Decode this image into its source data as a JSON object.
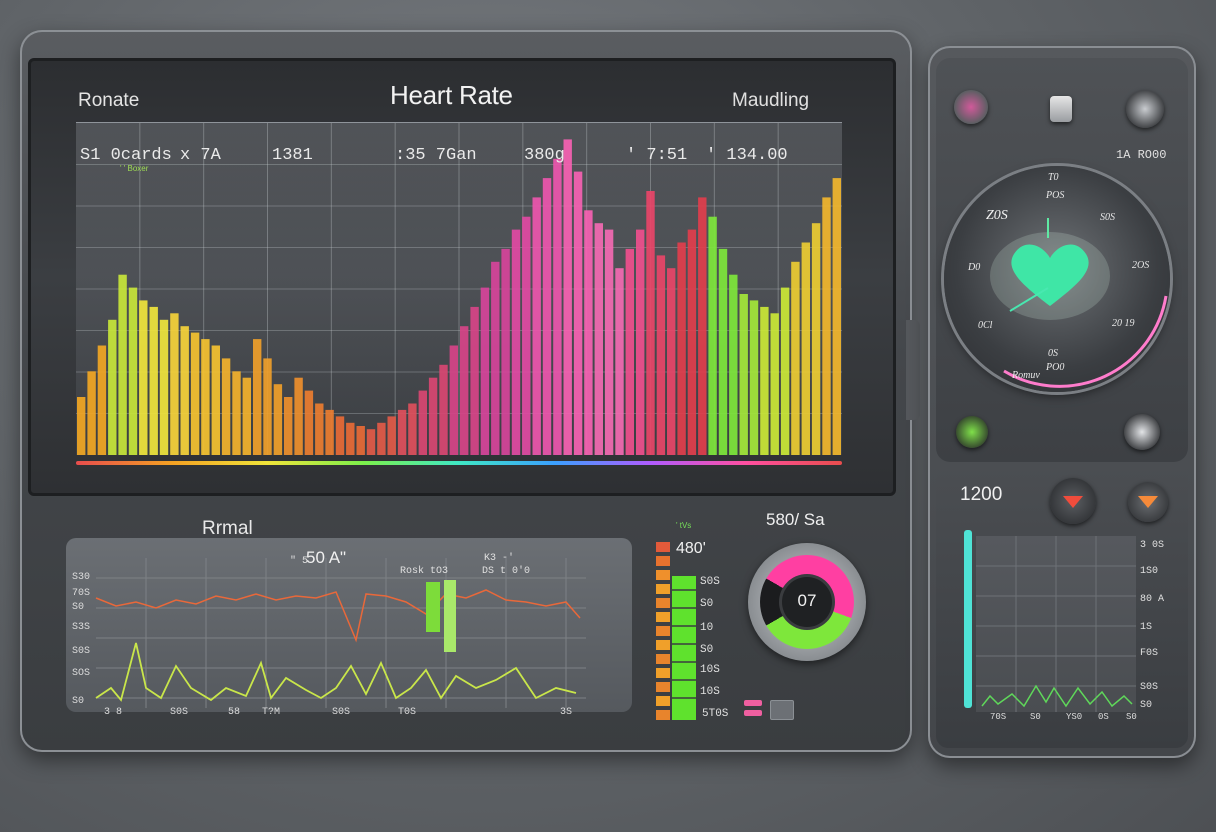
{
  "main_screen": {
    "title": "Heart Rate",
    "label_left": "Ronate",
    "label_right": "Maudling",
    "readouts": [
      "S1 0cards",
      "x 7A",
      "1381",
      ":35 7Gan",
      "380g",
      "' 7:51",
      "' 134.00"
    ],
    "tiny_caption": "' ' Boxer",
    "chart_data": {
      "type": "bar",
      "values": [
        18,
        26,
        34,
        42,
        56,
        52,
        48,
        46,
        42,
        44,
        40,
        38,
        36,
        34,
        30,
        26,
        24,
        36,
        30,
        22,
        18,
        24,
        20,
        16,
        14,
        12,
        10,
        9,
        8,
        10,
        12,
        14,
        16,
        20,
        24,
        28,
        34,
        40,
        46,
        52,
        60,
        64,
        70,
        74,
        80,
        86,
        92,
        98,
        88,
        76,
        72,
        70,
        58,
        64,
        70,
        82,
        62,
        58,
        66,
        70,
        80,
        74,
        64,
        56,
        50,
        48,
        46,
        44,
        52,
        60,
        66,
        72,
        80,
        86
      ],
      "colors": [
        "#f2a724",
        "#c8e63a",
        "#f0e53c",
        "#f6d23a",
        "#f5c230",
        "#f3b22c",
        "#f0a02a",
        "#ee8f2c",
        "#eb7d30",
        "#e86a36",
        "#e25a48",
        "#de4f5c",
        "#d94772",
        "#d74488",
        "#d6449a",
        "#e14aa3",
        "#ec56ac",
        "#f662b2",
        "#f36ab2",
        "#ef4f8d",
        "#e84568",
        "#e13e4c",
        "#7ee73b",
        "#a4e83a",
        "#cbe836",
        "#eccc32",
        "#f2b62c"
      ]
    },
    "gradient_colors": [
      "#e84d4d",
      "#f4a123",
      "#f0e43a",
      "#7cf04b",
      "#3fe7c5",
      "#3ba0ff",
      "#b05cff",
      "#ff4fa0"
    ]
  },
  "lower": {
    "label": "Rrmal",
    "ecg_mid": "50 A\"",
    "ecg_small_labels": [
      "\" 5",
      "Rosk tO3",
      "DS t 0'0",
      "K3 -'"
    ],
    "y_ticks": [
      "S30",
      "70S",
      "S0",
      "S3S",
      "S0S",
      "SOS",
      "S0"
    ],
    "x_ticks": [
      "3 8",
      "S0S",
      "58",
      "T?M",
      "S0S",
      "T0S",
      "3S"
    ],
    "bars": {
      "top_text": "' tVs",
      "value": "480'",
      "labels": [
        "S0S",
        "S0",
        "10",
        "S0",
        "10S",
        "10S",
        "5T0S"
      ]
    },
    "gauge": {
      "label": "580/ Sa",
      "value": "07"
    }
  },
  "right_panel": {
    "code": "1A RO00",
    "dial_labels": [
      "T0",
      "POS",
      "S0S",
      "2OS",
      "20 19",
      "0S",
      "PO0",
      "D0",
      "0Cl"
    ],
    "dial_big": "Z0S",
    "dial_bottom": "Romuv",
    "bottom_value": "1200",
    "y_ticks": [
      "3 0S",
      "1S0",
      "80 A",
      "1S",
      "F0S",
      "S0S",
      "S0"
    ],
    "x_ticks": [
      "70S",
      "S0",
      "YS0",
      "0S",
      "S0"
    ]
  }
}
